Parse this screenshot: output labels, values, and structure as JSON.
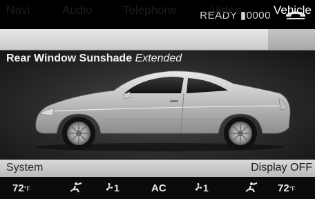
{
  "status": {
    "ready_text": "READY ▮0000"
  },
  "nav": {
    "items": [
      {
        "label": "Navi"
      },
      {
        "label": "Audio"
      },
      {
        "label": "Telephone"
      },
      {
        "label": "Video"
      },
      {
        "label": "Vehicle"
      }
    ],
    "active": "Vehicle"
  },
  "main": {
    "title": "Rear Window Sunshade",
    "status": "Extended"
  },
  "system_bar": {
    "label": "System",
    "display_off": "Display OFF"
  },
  "climate": {
    "temp_left": "72",
    "temp_right": "72",
    "unit": "°F",
    "fan_left": "1",
    "fan_right": "1",
    "ac": "AC"
  },
  "icons": {
    "phone": "phone-handset-icon",
    "airflow": "airflow-icon",
    "fan": "fan-icon"
  }
}
